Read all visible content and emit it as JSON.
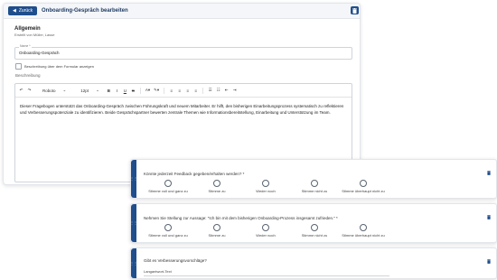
{
  "header": {
    "back_label": "Zurück",
    "title": "Onboarding-Gespräch bearbeiten"
  },
  "general": {
    "title": "Allgemein",
    "created_by": "Erstellt von Müller, Lasse"
  },
  "name_field": {
    "label": "Name *",
    "value": "Onboarding-Gespräch"
  },
  "show_description": {
    "label": "Beschreibung über dem Formular anzeigen",
    "checked": false
  },
  "description": {
    "label": "Beschreibung",
    "toolbar": {
      "font": "Roboto",
      "size": "12pt"
    },
    "text": "Dieser Fragebogen unterstützt das Onboarding-Gespräch zwischen Führungskraft und neuem Mitarbeiter. Er hilft, den bisherigen Einarbeitungsprozess systematisch zu reflektieren und Verbesserungspotenziale zu identifizieren. Beide Gesprächspartner bewerten zentrale Themen wie Informationsbereitstellung, Einarbeitung und Unterstützung im Team."
  },
  "questions": [
    {
      "text": "Könnte jederzeit Feedback gegeben/erhalten werden? *",
      "options": [
        "Stimme voll und ganz zu",
        "Stimme zu",
        "Weder noch",
        "Stimme nicht zu",
        "Stimme überhaupt nicht zu"
      ]
    },
    {
      "text": "Nehmen Sie Stellung zur Aussage: \"Ich bin mit dem bisherigen Onboarding-Prozess insgesamt zufrieden.\" *",
      "options": [
        "Stimme voll und ganz zu",
        "Stimme zu",
        "Weder noch",
        "Stimme nicht zu",
        "Stimme überhaupt nicht zu"
      ]
    },
    {
      "text": "Gibt es Verbesserungsvorschläge?",
      "answer_type": "Langantwort-Text"
    }
  ],
  "colors": {
    "accent": "#1f4e8c"
  }
}
